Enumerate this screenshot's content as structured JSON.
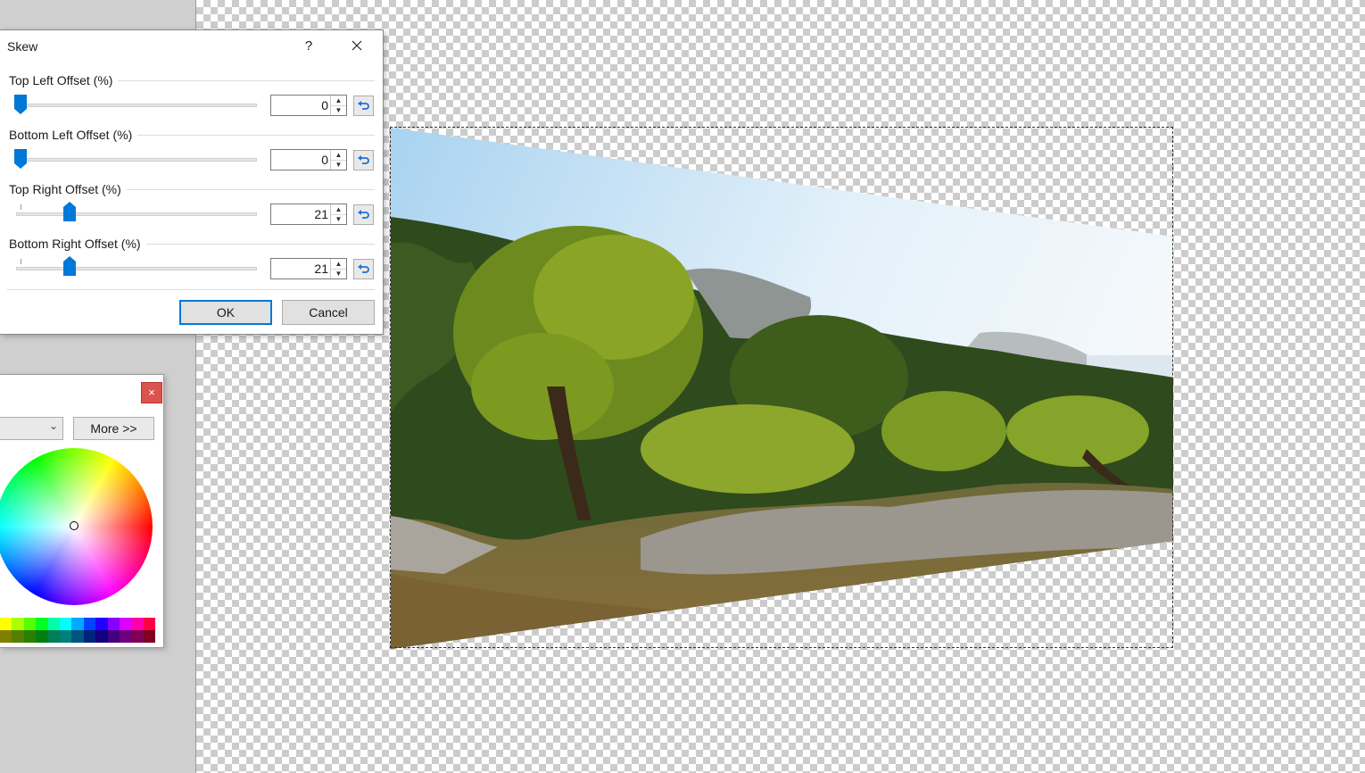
{
  "dialog": {
    "title": "Skew",
    "help_label": "?",
    "groups": [
      {
        "label": "Top Left Offset (%)",
        "value": "0",
        "level_percent": 0
      },
      {
        "label": "Bottom Left Offset (%)",
        "value": "0",
        "level_percent": 0
      },
      {
        "label": "Top Right Offset (%)",
        "value": "21",
        "level_percent": 21
      },
      {
        "label": "Bottom Right Offset (%)",
        "value": "21",
        "level_percent": 21
      }
    ],
    "ok_label": "OK",
    "cancel_label": "Cancel"
  },
  "colors_panel": {
    "close_label": "×",
    "more_label": "More >>",
    "palette_top": [
      "#ffff00",
      "#aaff00",
      "#55ff00",
      "#00ff22",
      "#00ffaa",
      "#00ffff",
      "#00aaff",
      "#0044ff",
      "#2200ff",
      "#8800ff",
      "#dd00ff",
      "#ff00aa",
      "#ff0044"
    ],
    "palette_bottom": [
      "#7f7f00",
      "#557f00",
      "#2a7f00",
      "#007f11",
      "#007f55",
      "#007f7f",
      "#00557f",
      "#00227f",
      "#11007f",
      "#44007f",
      "#6e007f",
      "#7f0055",
      "#7f0022"
    ]
  },
  "canvas": {
    "checker_light": "#ffffff",
    "checker_dark": "#cccccc"
  }
}
